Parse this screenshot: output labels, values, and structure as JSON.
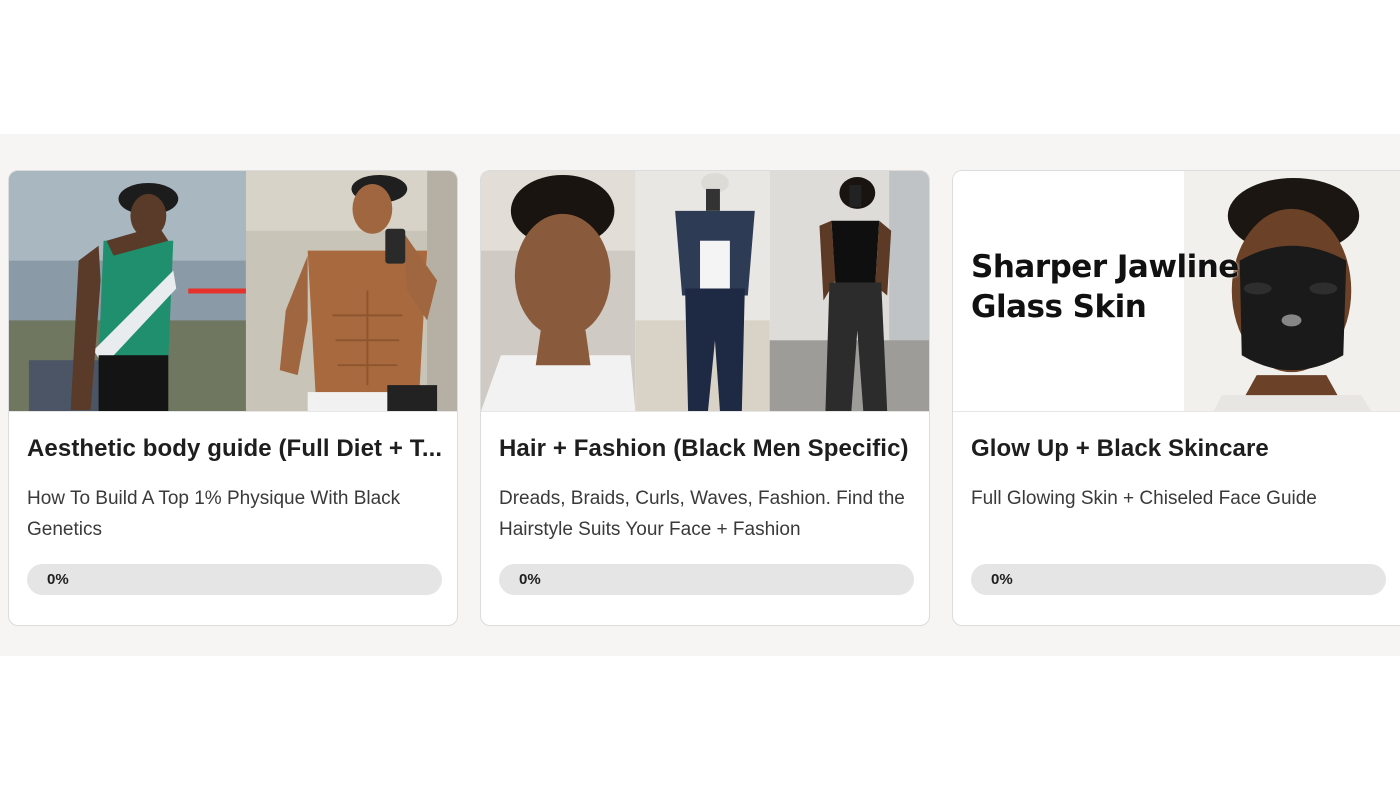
{
  "courses": [
    {
      "title": "Aesthetic body guide (Full Diet + T...",
      "description": "How To Build A Top 1% Physique With Black Genetics",
      "progress_label": "0%",
      "progress": 0
    },
    {
      "title": "Hair + Fashion (Black Men Specific)",
      "description": "Dreads, Braids, Curls, Waves, Fashion. Find the Hairstyle Suits Your Face + Fashion",
      "progress_label": "0%",
      "progress": 0
    },
    {
      "title": "Glow Up + Black Skincare",
      "description": "Full Glowing Skin + Chiseled Face Guide",
      "progress_label": "0%",
      "progress": 0,
      "thumbnail_text": {
        "line1": "Sharper Jawline",
        "line2": "Glass Skin"
      }
    }
  ]
}
